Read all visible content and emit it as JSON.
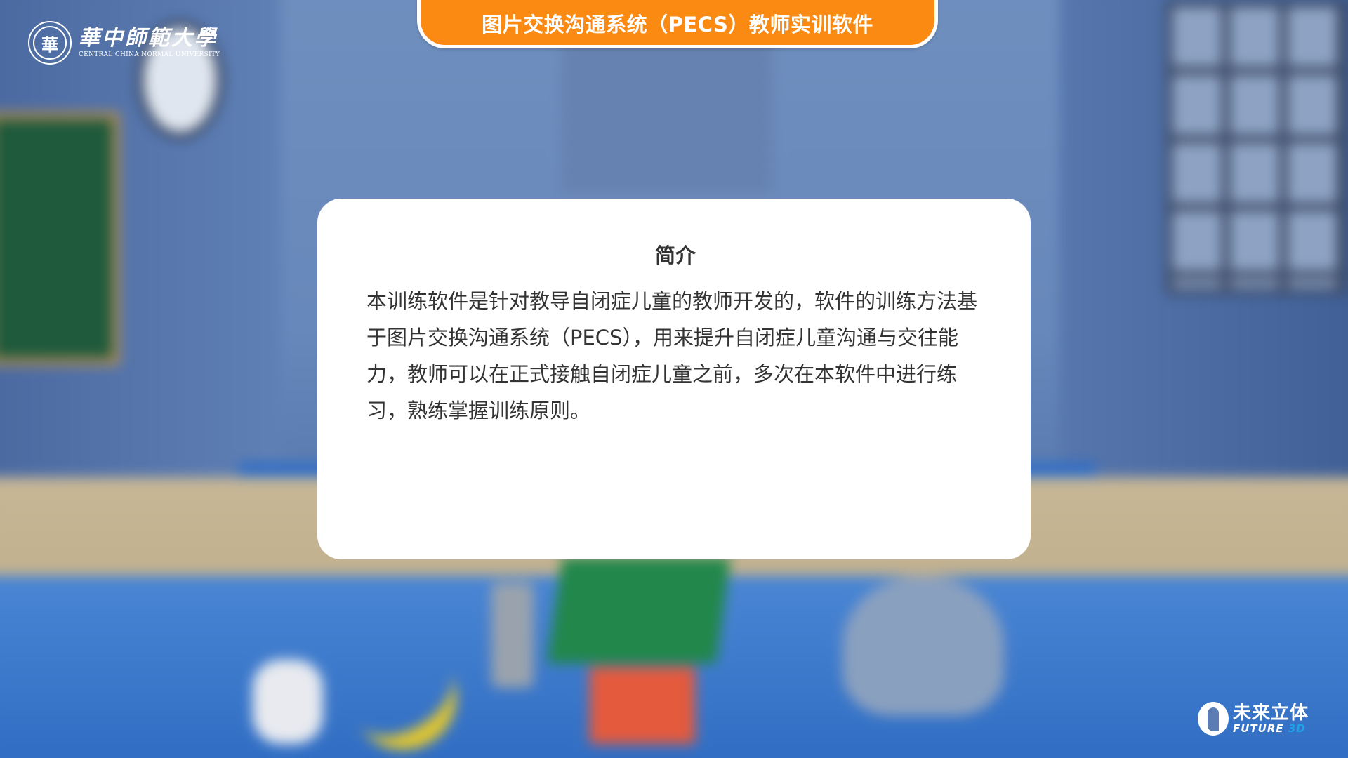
{
  "header": {
    "title": "图片交换沟通系统（PECS）教师实训软件"
  },
  "university_logo": {
    "seal_char": "華",
    "name_cn": "華中師範大學",
    "name_en": "CENTRAL CHINA NORMAL UNIVERSITY"
  },
  "intro_dialog": {
    "title": "简介",
    "body": "本训练软件是针对教导自闭症儿童的教师开发的，软件的训练方法基于图片交换沟通系统（PECS），用来提升自闭症儿童沟通与交往能力，教师可以在正式接触自闭症儿童之前，多次在本软件中进行练习，熟练掌握训练原则。"
  },
  "brand_logo": {
    "name_cn": "未来立体",
    "name_en_main": "FUTURE",
    "name_en_accent": "3D"
  },
  "colors": {
    "accent": "#fa8a12",
    "dialog_bg": "#ffffff",
    "text": "#333333"
  }
}
